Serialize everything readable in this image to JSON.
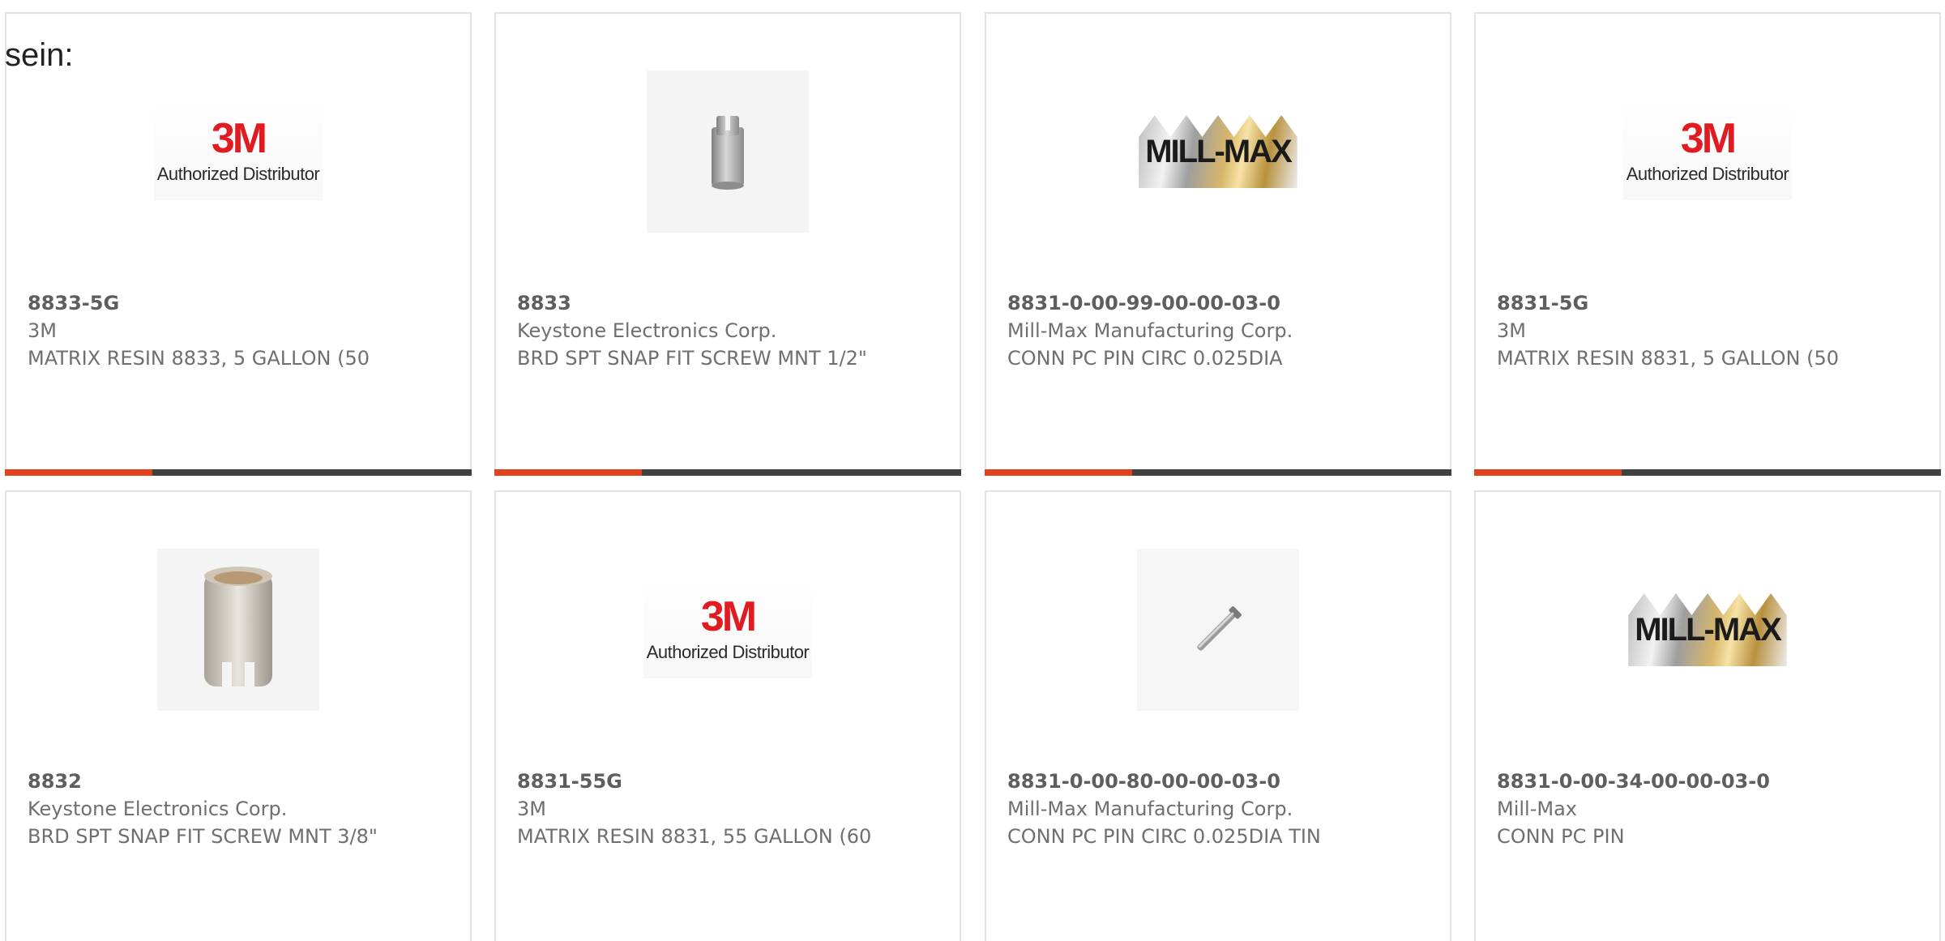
{
  "intro_text": "sein:",
  "accent_colors": {
    "accent": "#e0421e",
    "bar": "#404040"
  },
  "products": [
    {
      "part_number": "8833-5G",
      "manufacturer": "3M",
      "description": "MATRIX RESIN 8833, 5 GALLON (50",
      "image": "3m-authorized-distributor-logo",
      "logo_mark": "3M",
      "logo_text": "Authorized Distributor"
    },
    {
      "part_number": "8833",
      "manufacturer": "Keystone Electronics Corp.",
      "description": "BRD SPT SNAP FIT SCREW MNT 1/2\"",
      "image": "snap-fit-screw-mount-photo"
    },
    {
      "part_number": "8831-0-00-99-00-00-03-0",
      "manufacturer": "Mill-Max Manufacturing Corp.",
      "description": "CONN PC PIN CIRC 0.025DIA",
      "image": "mill-max-logo",
      "logo_mark": "MILL-MAX"
    },
    {
      "part_number": "8831-5G",
      "manufacturer": "3M",
      "description": "MATRIX RESIN 8831, 5 GALLON (50",
      "image": "3m-authorized-distributor-logo",
      "logo_mark": "3M",
      "logo_text": "Authorized Distributor"
    },
    {
      "part_number": "8832",
      "manufacturer": "Keystone Electronics Corp.",
      "description": "BRD SPT SNAP FIT SCREW MNT 3/8\"",
      "image": "snap-fit-screw-mount-photo"
    },
    {
      "part_number": "8831-55G",
      "manufacturer": "3M",
      "description": "MATRIX RESIN 8831, 55 GALLON (60",
      "image": "3m-authorized-distributor-logo",
      "logo_mark": "3M",
      "logo_text": "Authorized Distributor"
    },
    {
      "part_number": "8831-0-00-80-00-00-03-0",
      "manufacturer": "Mill-Max Manufacturing Corp.",
      "description": "CONN PC PIN CIRC 0.025DIA TIN",
      "image": "pc-pin-photo"
    },
    {
      "part_number": "8831-0-00-34-00-00-03-0",
      "manufacturer": "Mill-Max",
      "description": "CONN PC PIN",
      "image": "mill-max-logo",
      "logo_mark": "MILL-MAX"
    }
  ]
}
